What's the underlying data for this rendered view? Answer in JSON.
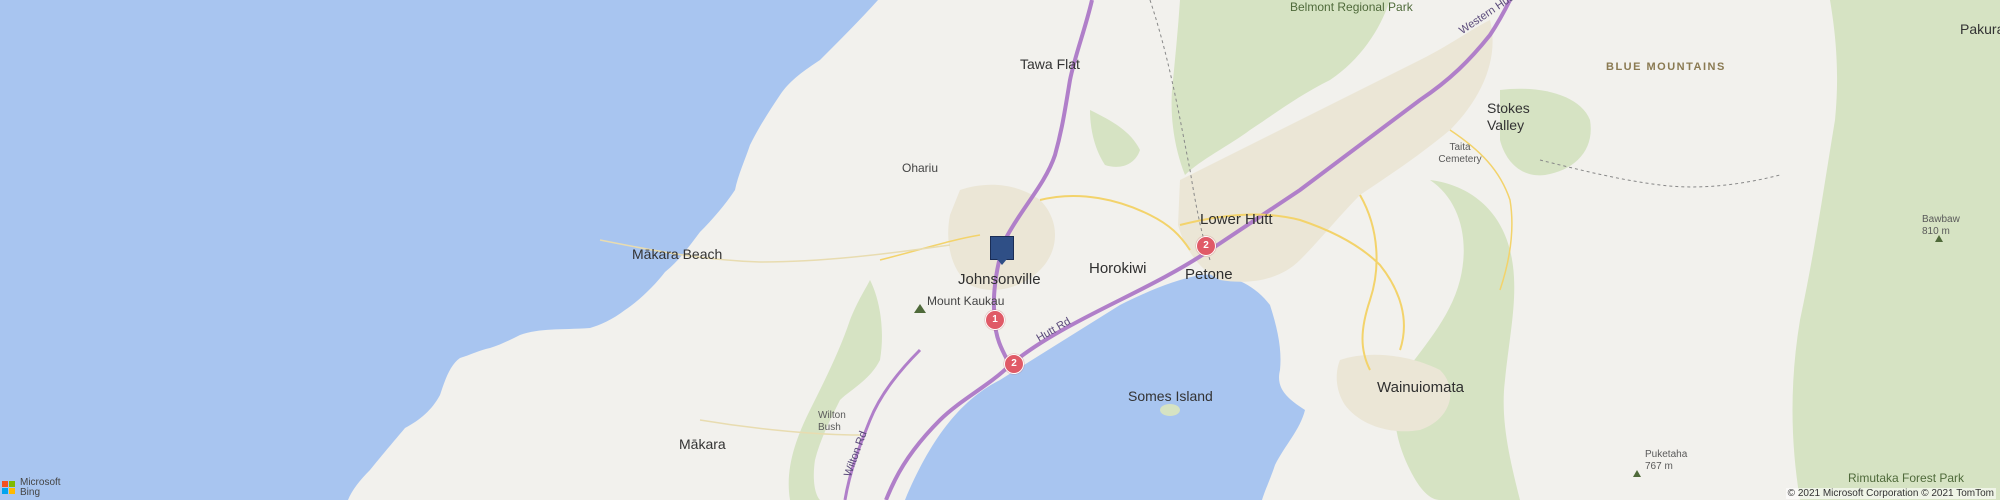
{
  "map": {
    "colors": {
      "water": "#a8c5f0",
      "land": "#f2f1ed",
      "park": "#d6e3c3",
      "urban": "#ebe6d6",
      "motorway": "#b07fc9",
      "road": "#f3d36b"
    },
    "places": {
      "tawa_flat": "Tawa Flat",
      "ohariu": "Ohariu",
      "makara_beach": "Mākara Beach",
      "johnsonville": "Johnsonville",
      "mount_kaukau": "Mount Kaukau",
      "horokiwi": "Horokiwi",
      "lower_hutt": "Lower Hutt",
      "petone": "Petone",
      "somes_island": "Somes Island",
      "wainuiomata": "Wainuiomata",
      "makara": "Mākara",
      "wilton_bush": "Wilton Bush",
      "stokes_valley": "Stokes Valley",
      "taita_cemetery": "Taita Cemetery",
      "belmont_regional_park": "Belmont Regional Park",
      "blue_mountains": "BLUE MOUNTAINS",
      "pakuratahi": "Pakura",
      "bawbaw": "Bawbaw",
      "bawbaw_elev": "810 m",
      "puketaha": "Puketaha",
      "puketaha_elev": "767 m",
      "rimutaka_forest_park": "Rimutaka Forest Park"
    },
    "roads": {
      "western_hutt": "Western Hutt",
      "hutt_rd": "Hutt Rd",
      "wilton_rd": "Wilton Rd"
    },
    "shields": [
      "1",
      "2",
      "2"
    ],
    "icons": {
      "pin": "location-pin-icon",
      "peak": "mountain-peak-icon",
      "logo": "microsoft-logo-icon"
    },
    "footer": {
      "copyright": "© 2021 Microsoft Corporation © 2021 TomTom",
      "brand_line1": "Microsoft",
      "brand_line2": "Bing"
    }
  }
}
